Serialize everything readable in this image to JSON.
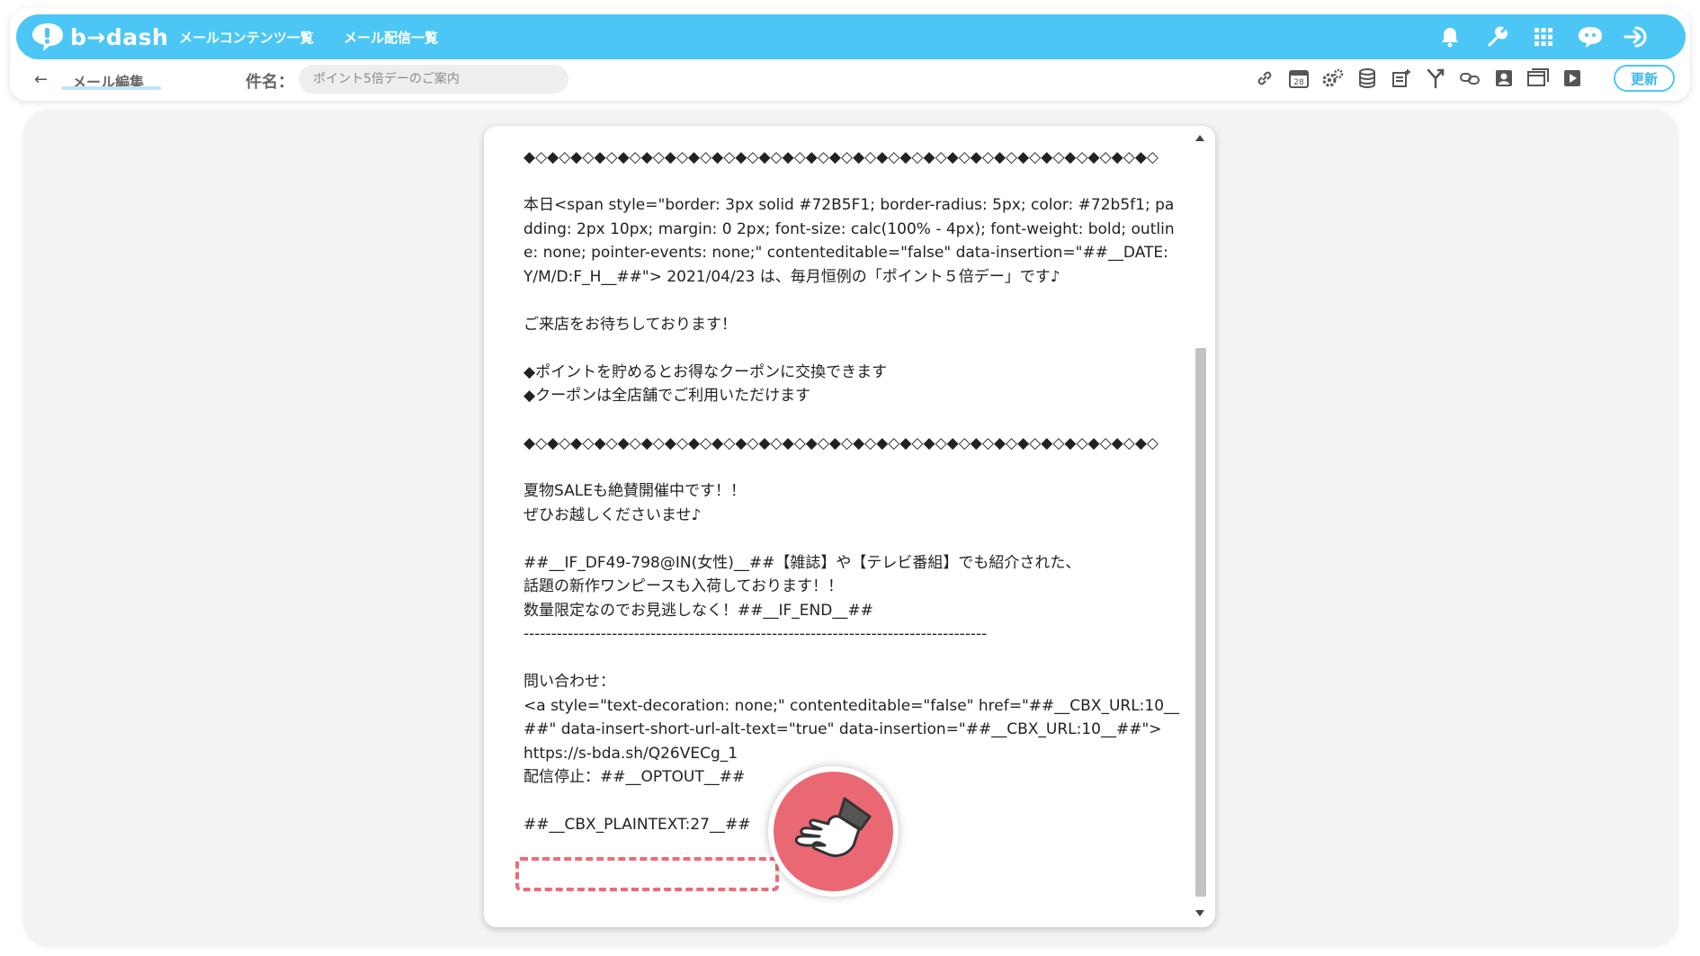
{
  "app": {
    "logo_text": "b→dash"
  },
  "nav": {
    "links": [
      "メールコンテンツ一覧",
      "メール配信一覧"
    ],
    "icons": [
      "bell-icon",
      "wrench-icon",
      "apps-grid-icon",
      "chat-bot-icon",
      "logout-icon"
    ]
  },
  "subbar": {
    "back_glyph": "←",
    "title": "メール編集",
    "subject_label": "件名：",
    "subject_placeholder": "ポイント5倍デーのご案内",
    "toolbar_icons": [
      "link-icon",
      "calendar-icon",
      "settings-gears-icon",
      "database-icon",
      "add-note-icon",
      "branch-icon",
      "link-chain-icon",
      "profile-card-icon",
      "window-icon",
      "play-icon"
    ],
    "calendar_day": "28",
    "update_label": "更新"
  },
  "email_body": {
    "lines": [
      "◆◇◆◇◆◇◆◇◆◇◆◇◆◇◆◇◆◇◆◇◆◇◆◇◆◇◆◇◆◇◆◇◆◇◆◇◆◇◆◇◆◇◆◇◆◇◆◇◆◇◆◇◆◇",
      "",
      "本日<span style=\"border: 3px solid #72B5F1; border-radius: 5px; color: #72b5f1; padding: 2px 10px; margin: 0 2px; font-size: calc(100% - 4px); font-weight: bold; outline: none; pointer-events: none;\" contenteditable=\"false\" data-insertion=\"##__DATE:Y/M/D:F_H__##\"> 2021/04/23 は、毎月恒例の「ポイント５倍デー」です♪",
      "",
      "ご来店をお待ちしております！",
      "",
      "◆ポイントを貯めるとお得なクーポンに交換できます",
      "◆クーポンは全店舗でご利用いただけます",
      "",
      "◆◇◆◇◆◇◆◇◆◇◆◇◆◇◆◇◆◇◆◇◆◇◆◇◆◇◆◇◆◇◆◇◆◇◆◇◆◇◆◇◆◇◆◇◆◇◆◇◆◇◆◇◆◇",
      "",
      "夏物SALEも絶賛開催中です！！",
      "ぜひお越しくださいませ♪",
      "",
      "##__IF_DF49-798@IN(女性)__##【雑誌】や【テレビ番組】でも紹介された、",
      "話題の新作ワンピースも入荷しております！！",
      "数量限定なのでお見逃しなく！##__IF_END__##",
      "------------------------------------------------------------------------------------",
      "",
      "問い合わせ：",
      "<a style=\"text-decoration: none;\" contenteditable=\"false\" href=\"##__CBX_URL:10__##\" data-insert-short-url-alt-text=\"true\" data-insertion=\"##__CBX_URL:10__##\">",
      "https://s-bda.sh/Q26VECg_1",
      "配信停止：##__OPTOUT__##",
      "",
      "##__CBX_PLAINTEXT:27__##"
    ]
  },
  "colors": {
    "navbar": "#4cc7f5",
    "highlight": "#ee6b77"
  }
}
